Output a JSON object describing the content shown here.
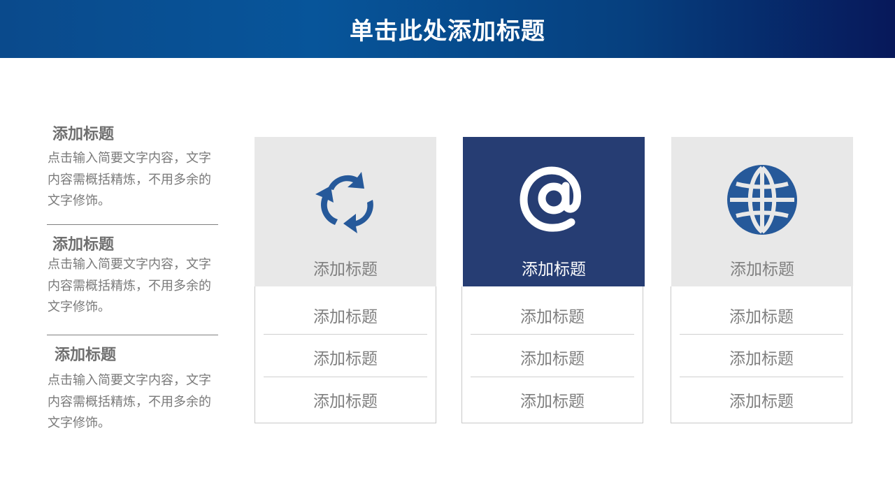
{
  "slide": {
    "title": "单击此处添加标题"
  },
  "left_items": [
    {
      "title": "添加标题",
      "body": "点击输入简要文字内容，文字内容需概括精炼，不用多余的文字修饰。"
    },
    {
      "title": "添加标题",
      "body": "点击输入简要文字内容，文字内容需概括精炼，不用多余的文字修饰。"
    },
    {
      "title": "添加标题",
      "body": "点击输入简要文字内容，文字内容需概括精炼，不用多余的文字修饰。"
    }
  ],
  "cards": [
    {
      "icon": "recycle-arrows-icon",
      "label": "添加标题",
      "rows": [
        "添加标题",
        "添加标题",
        "添加标题"
      ],
      "highlighted": false
    },
    {
      "icon": "at-sign-icon",
      "label": "添加标题",
      "rows": [
        "添加标题",
        "添加标题",
        "添加标题"
      ],
      "highlighted": true
    },
    {
      "icon": "globe-icon",
      "label": "添加标题",
      "rows": [
        "添加标题",
        "添加标题",
        "添加标题"
      ],
      "highlighted": false
    }
  ],
  "colors": {
    "title_bar_start": "#0a4a8c",
    "title_bar_end": "#07185a",
    "card_dark": "#263d73",
    "card_light": "#e8e8e8",
    "icon_blue": "#26599a",
    "text_gray": "#7f7f7f"
  }
}
